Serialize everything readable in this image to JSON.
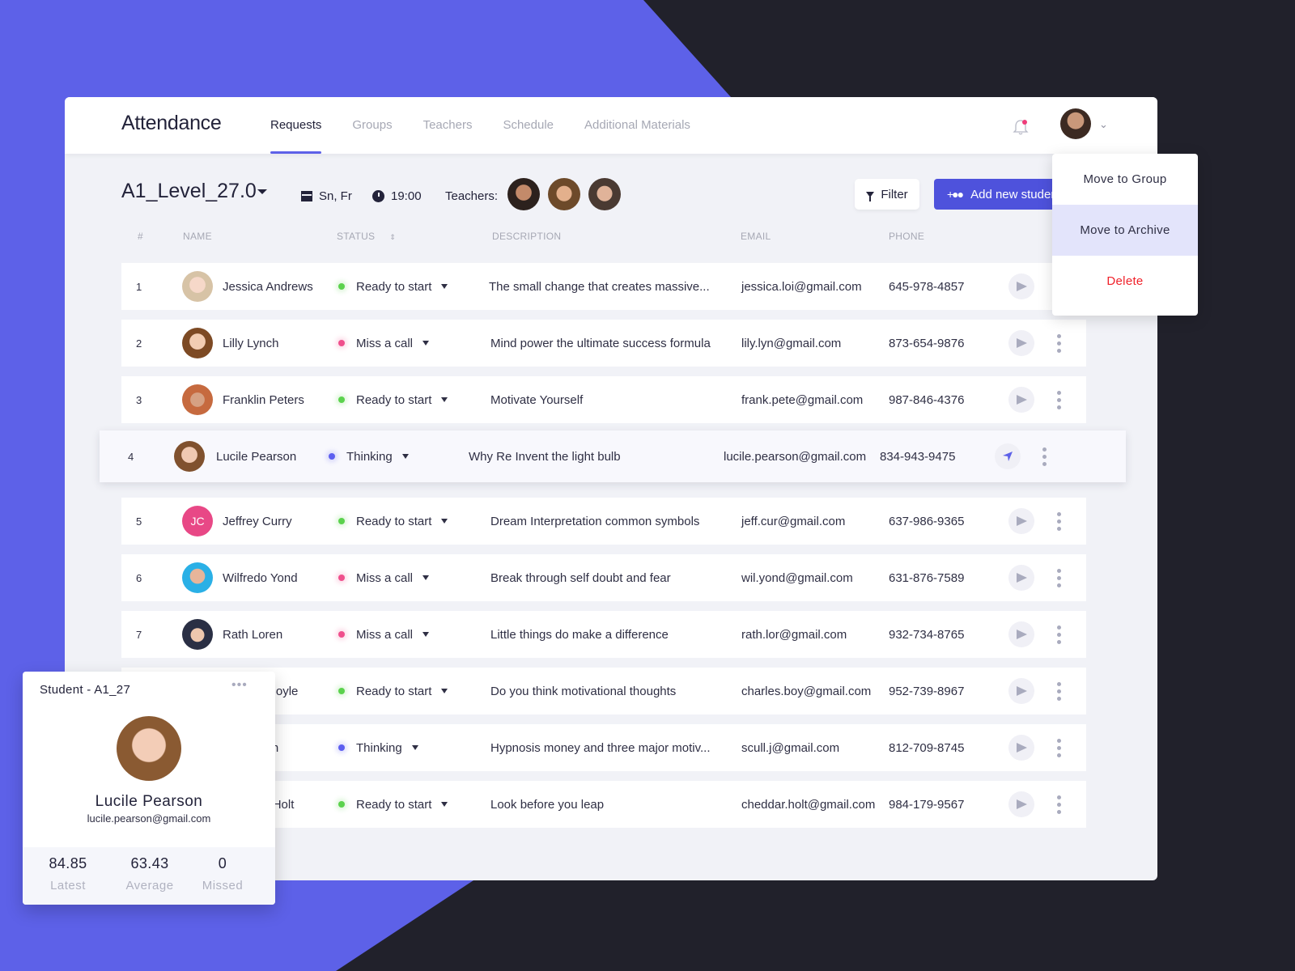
{
  "colors": {
    "accent": "#5d61e8",
    "background_dark": "#21212b",
    "status_ready": "#5bd24d",
    "status_miss": "#ef4f8c",
    "status_thinking": "#5d5ff0",
    "danger": "#f0212a"
  },
  "header": {
    "title": "Attendance",
    "tabs": [
      {
        "label": "Requests",
        "active": true
      },
      {
        "label": "Groups",
        "active": false
      },
      {
        "label": "Teachers",
        "active": false
      },
      {
        "label": "Schedule",
        "active": false
      },
      {
        "label": "Additional Materials",
        "active": false
      }
    ],
    "notification_icon": "bell-icon",
    "user_menu_icon": "chevron-down-icon"
  },
  "toolbar": {
    "group_name": "A1_Level_27.0",
    "days": "Sn, Fr",
    "time": "19:00",
    "teachers_label": "Teachers:",
    "filter_label": "Filter",
    "add_label": "Add new student"
  },
  "table": {
    "columns": [
      "#",
      "NAME",
      "STATUS",
      "DESCRIPTION",
      "EMAIL",
      "PHONE"
    ],
    "rows": [
      {
        "num": "1",
        "name": "Jessica Andrews",
        "status": "Ready to start",
        "status_type": "ready",
        "description": "The small change that creates massive...",
        "email": "jessica.loi@gmail.com",
        "phone": "645-978-4857"
      },
      {
        "num": "2",
        "name": "Lilly Lynch",
        "status": "Miss a call",
        "status_type": "miss",
        "description": "Mind power the ultimate success formula",
        "email": "lily.lyn@gmail.com",
        "phone": "873-654-9876"
      },
      {
        "num": "3",
        "name": "Franklin Peters",
        "status": "Ready to start",
        "status_type": "ready",
        "description": "Motivate Yourself",
        "email": "frank.pete@gmail.com",
        "phone": "987-846-4376"
      },
      {
        "num": "4",
        "name": "Lucile Pearson",
        "status": "Thinking",
        "status_type": "thinking",
        "description": "Why Re Invent the light bulb",
        "email": "lucile.pearson@gmail.com",
        "phone": "834-943-9475",
        "selected": true
      },
      {
        "num": "5",
        "name": "Jeffrey Curry",
        "initials": "JC",
        "status": "Ready to start",
        "status_type": "ready",
        "description": "Dream Interpretation common symbols",
        "email": "jeff.cur@gmail.com",
        "phone": "637-986-9365"
      },
      {
        "num": "6",
        "name": "Wilfredo Yond",
        "status": "Miss a call",
        "status_type": "miss",
        "description": "Break through self doubt and fear",
        "email": "wil.yond@gmail.com",
        "phone": "631-876-7589"
      },
      {
        "num": "7",
        "name": "Rath Loren",
        "status": "Miss a call",
        "status_type": "miss",
        "description": "Little things do make a difference",
        "email": "rath.lor@gmail.com",
        "phone": "932-734-8765"
      },
      {
        "num": "8",
        "name": "Charles Boyle",
        "status": "Ready to start",
        "status_type": "ready",
        "description": "Do you think motivational thoughts",
        "email": "charles.boy@gmail.com",
        "phone": "952-739-8967"
      },
      {
        "num": "9",
        "name": "Scull John",
        "status": "Thinking",
        "status_type": "thinking",
        "description": "Hypnosis money and three major motiv...",
        "email": "scull.j@gmail.com",
        "phone": "812-709-8745"
      },
      {
        "num": "10",
        "name": "Cheddar Holt",
        "status": "Ready to start",
        "status_type": "ready",
        "description": "Look before you leap",
        "email": "cheddar.holt@gmail.com",
        "phone": "984-179-9567"
      }
    ]
  },
  "context_menu": {
    "items": [
      {
        "label": "Move to Group"
      },
      {
        "label": "Move to Archive",
        "hover": true
      },
      {
        "label": "Delete",
        "danger": true
      }
    ]
  },
  "student_card": {
    "title": "Student - A1_27",
    "name": "Lucile Pearson",
    "email": "lucile.pearson@gmail.com",
    "stats": [
      {
        "value": "84.85",
        "label": "Latest"
      },
      {
        "value": "63.43",
        "label": "Average"
      },
      {
        "value": "0",
        "label": "Missed"
      }
    ]
  }
}
